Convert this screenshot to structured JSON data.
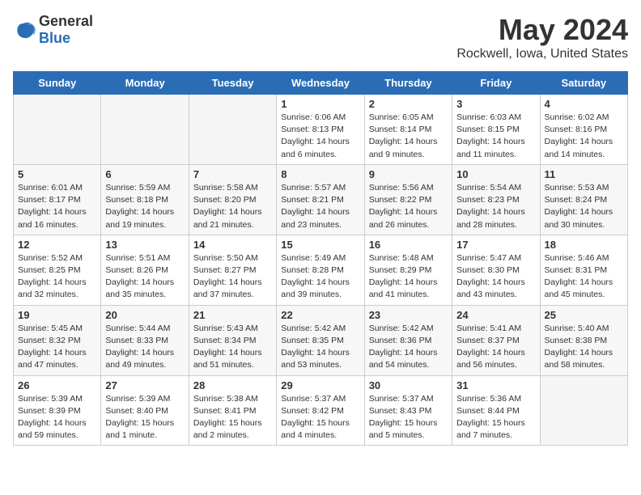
{
  "logo": {
    "general": "General",
    "blue": "Blue"
  },
  "header": {
    "month": "May 2024",
    "location": "Rockwell, Iowa, United States"
  },
  "days_of_week": [
    "Sunday",
    "Monday",
    "Tuesday",
    "Wednesday",
    "Thursday",
    "Friday",
    "Saturday"
  ],
  "weeks": [
    [
      {
        "day": "",
        "info": ""
      },
      {
        "day": "",
        "info": ""
      },
      {
        "day": "",
        "info": ""
      },
      {
        "day": "1",
        "info": "Sunrise: 6:06 AM\nSunset: 8:13 PM\nDaylight: 14 hours\nand 6 minutes."
      },
      {
        "day": "2",
        "info": "Sunrise: 6:05 AM\nSunset: 8:14 PM\nDaylight: 14 hours\nand 9 minutes."
      },
      {
        "day": "3",
        "info": "Sunrise: 6:03 AM\nSunset: 8:15 PM\nDaylight: 14 hours\nand 11 minutes."
      },
      {
        "day": "4",
        "info": "Sunrise: 6:02 AM\nSunset: 8:16 PM\nDaylight: 14 hours\nand 14 minutes."
      }
    ],
    [
      {
        "day": "5",
        "info": "Sunrise: 6:01 AM\nSunset: 8:17 PM\nDaylight: 14 hours\nand 16 minutes."
      },
      {
        "day": "6",
        "info": "Sunrise: 5:59 AM\nSunset: 8:18 PM\nDaylight: 14 hours\nand 19 minutes."
      },
      {
        "day": "7",
        "info": "Sunrise: 5:58 AM\nSunset: 8:20 PM\nDaylight: 14 hours\nand 21 minutes."
      },
      {
        "day": "8",
        "info": "Sunrise: 5:57 AM\nSunset: 8:21 PM\nDaylight: 14 hours\nand 23 minutes."
      },
      {
        "day": "9",
        "info": "Sunrise: 5:56 AM\nSunset: 8:22 PM\nDaylight: 14 hours\nand 26 minutes."
      },
      {
        "day": "10",
        "info": "Sunrise: 5:54 AM\nSunset: 8:23 PM\nDaylight: 14 hours\nand 28 minutes."
      },
      {
        "day": "11",
        "info": "Sunrise: 5:53 AM\nSunset: 8:24 PM\nDaylight: 14 hours\nand 30 minutes."
      }
    ],
    [
      {
        "day": "12",
        "info": "Sunrise: 5:52 AM\nSunset: 8:25 PM\nDaylight: 14 hours\nand 32 minutes."
      },
      {
        "day": "13",
        "info": "Sunrise: 5:51 AM\nSunset: 8:26 PM\nDaylight: 14 hours\nand 35 minutes."
      },
      {
        "day": "14",
        "info": "Sunrise: 5:50 AM\nSunset: 8:27 PM\nDaylight: 14 hours\nand 37 minutes."
      },
      {
        "day": "15",
        "info": "Sunrise: 5:49 AM\nSunset: 8:28 PM\nDaylight: 14 hours\nand 39 minutes."
      },
      {
        "day": "16",
        "info": "Sunrise: 5:48 AM\nSunset: 8:29 PM\nDaylight: 14 hours\nand 41 minutes."
      },
      {
        "day": "17",
        "info": "Sunrise: 5:47 AM\nSunset: 8:30 PM\nDaylight: 14 hours\nand 43 minutes."
      },
      {
        "day": "18",
        "info": "Sunrise: 5:46 AM\nSunset: 8:31 PM\nDaylight: 14 hours\nand 45 minutes."
      }
    ],
    [
      {
        "day": "19",
        "info": "Sunrise: 5:45 AM\nSunset: 8:32 PM\nDaylight: 14 hours\nand 47 minutes."
      },
      {
        "day": "20",
        "info": "Sunrise: 5:44 AM\nSunset: 8:33 PM\nDaylight: 14 hours\nand 49 minutes."
      },
      {
        "day": "21",
        "info": "Sunrise: 5:43 AM\nSunset: 8:34 PM\nDaylight: 14 hours\nand 51 minutes."
      },
      {
        "day": "22",
        "info": "Sunrise: 5:42 AM\nSunset: 8:35 PM\nDaylight: 14 hours\nand 53 minutes."
      },
      {
        "day": "23",
        "info": "Sunrise: 5:42 AM\nSunset: 8:36 PM\nDaylight: 14 hours\nand 54 minutes."
      },
      {
        "day": "24",
        "info": "Sunrise: 5:41 AM\nSunset: 8:37 PM\nDaylight: 14 hours\nand 56 minutes."
      },
      {
        "day": "25",
        "info": "Sunrise: 5:40 AM\nSunset: 8:38 PM\nDaylight: 14 hours\nand 58 minutes."
      }
    ],
    [
      {
        "day": "26",
        "info": "Sunrise: 5:39 AM\nSunset: 8:39 PM\nDaylight: 14 hours\nand 59 minutes."
      },
      {
        "day": "27",
        "info": "Sunrise: 5:39 AM\nSunset: 8:40 PM\nDaylight: 15 hours\nand 1 minute."
      },
      {
        "day": "28",
        "info": "Sunrise: 5:38 AM\nSunset: 8:41 PM\nDaylight: 15 hours\nand 2 minutes."
      },
      {
        "day": "29",
        "info": "Sunrise: 5:37 AM\nSunset: 8:42 PM\nDaylight: 15 hours\nand 4 minutes."
      },
      {
        "day": "30",
        "info": "Sunrise: 5:37 AM\nSunset: 8:43 PM\nDaylight: 15 hours\nand 5 minutes."
      },
      {
        "day": "31",
        "info": "Sunrise: 5:36 AM\nSunset: 8:44 PM\nDaylight: 15 hours\nand 7 minutes."
      },
      {
        "day": "",
        "info": ""
      }
    ]
  ]
}
